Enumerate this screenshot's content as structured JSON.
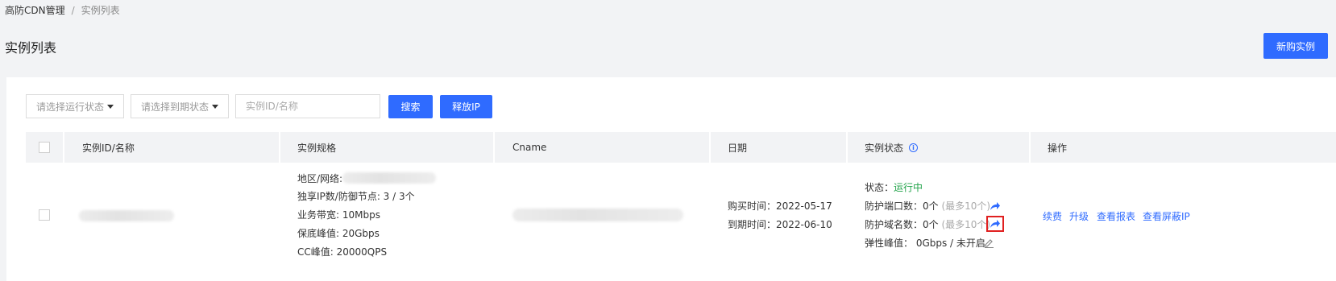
{
  "breadcrumb": {
    "root": "高防CDN管理",
    "separator": "/",
    "current": "实例列表"
  },
  "page": {
    "title": "实例列表",
    "new_instance_label": "新购实例"
  },
  "filters": {
    "run_status_placeholder": "请选择运行状态",
    "expiry_status_placeholder": "请选择到期状态",
    "search_placeholder": "实例ID/名称",
    "search_label": "搜索",
    "release_ip_label": "释放IP"
  },
  "table": {
    "headers": {
      "id_name": "实例ID/名称",
      "spec": "实例规格",
      "cname": "Cname",
      "date": "日期",
      "status": "实例状态",
      "actions": "操作"
    },
    "row": {
      "spec": {
        "region_label": "地区/网络:",
        "ip_nodes": "独享IP数/防御节点: 3 / 3个",
        "bandwidth": "业务带宽: 10Mbps",
        "guarantee_peak": "保底峰值: 20Gbps",
        "cc_peak": "CC峰值: 20000QPS"
      },
      "date": {
        "purchase": "购买时间：2022-05-17",
        "expiry": "到期时间：2022-06-10"
      },
      "status": {
        "state_label": "状态：",
        "state_value": "运行中",
        "ports_label": "防护端口数：",
        "ports_value": "0个",
        "ports_max": "(最多10个)",
        "domains_label": "防护域名数：",
        "domains_value": "0个",
        "domains_max": "(最多10个)",
        "elastic": "弹性峰值：  0Gbps / 未开启"
      },
      "actions": {
        "renew": "续费",
        "upgrade": "升级",
        "report": "查看报表",
        "blocked_ip": "查看屏蔽IP"
      }
    }
  },
  "colors": {
    "primary": "#2f6bff",
    "running": "#22a34a",
    "highlight": "#e02020"
  }
}
